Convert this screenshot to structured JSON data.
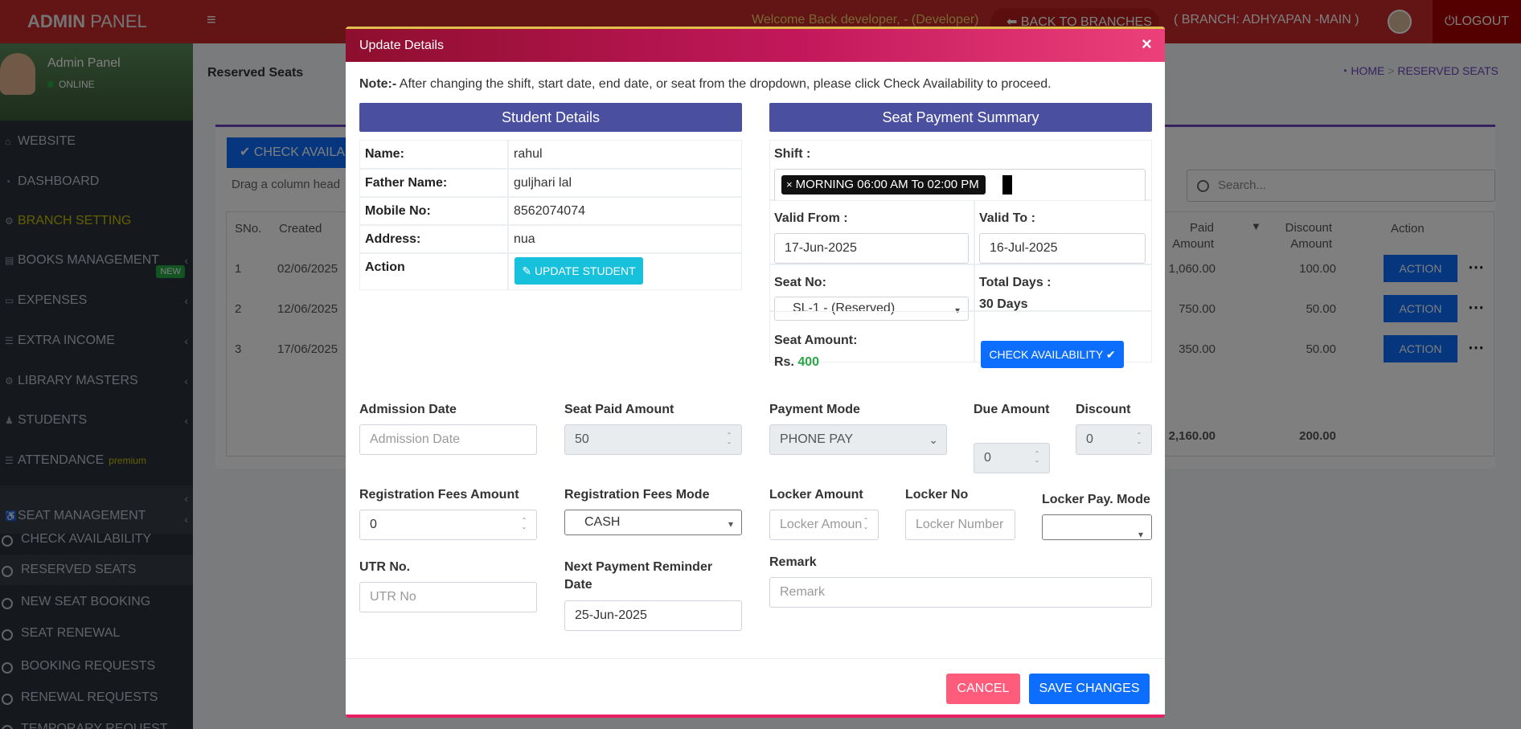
{
  "topbar": {
    "brand_bold": "ADMIN",
    "brand_rest": " PANEL",
    "welcome": "Welcome Back developer, - (Developer)",
    "back_to_branches": "BACK TO BRANCHES",
    "branch": "( BRANCH: ADHYAPAN -MAIN )",
    "logout": "LOGOUT"
  },
  "sidebar": {
    "user_name": "Admin Panel",
    "user_status": "ONLINE",
    "items": [
      {
        "label": "WEBSITE"
      },
      {
        "label": "DASHBOARD"
      },
      {
        "label": "BRANCH SETTING"
      },
      {
        "label": "BOOKS MANAGEMENT",
        "badge": "NEW"
      },
      {
        "label": "EXPENSES"
      },
      {
        "label": "EXTRA INCOME"
      },
      {
        "label": "LIBRARY MASTERS"
      },
      {
        "label": "STUDENTS"
      },
      {
        "label": "ATTENDANCE",
        "badge": "premium"
      },
      {
        "label": "SEAT MANAGEMENT"
      }
    ],
    "sub_items": [
      {
        "label": "CHECK AVAILABILITY"
      },
      {
        "label": "RESERVED SEATS"
      },
      {
        "label": "NEW SEAT BOOKING"
      },
      {
        "label": "SEAT RENEWAL"
      },
      {
        "label": "BOOKING REQUESTS"
      },
      {
        "label": "RENEWAL REQUESTS"
      },
      {
        "label": "TEMPORARY REQUEST"
      }
    ]
  },
  "page": {
    "title": "Reserved Seats",
    "breadcrumb_home": "HOME",
    "breadcrumb_current": "RESERVED SEATS",
    "check_button": "CHECK AVAILA",
    "drag_hint": "Drag a column head",
    "search_placeholder": "Search...",
    "table": {
      "headers": {
        "sno": "SNo.",
        "created": "Created",
        "paid": "Paid Amount",
        "discount": "Discount Amount",
        "action": "Action"
      },
      "rows": [
        {
          "sno": "1",
          "created": "02/06/2025",
          "paid": "1,060.00",
          "discount": "100.00",
          "action": "ACTION"
        },
        {
          "sno": "2",
          "created": "12/06/2025",
          "paid": "750.00",
          "discount": "50.00",
          "action": "ACTION"
        },
        {
          "sno": "3",
          "created": "17/06/2025",
          "paid": "350.00",
          "discount": "50.00",
          "action": "ACTION"
        }
      ],
      "total_paid": "2,160.00",
      "total_discount": "200.00"
    }
  },
  "modal": {
    "title": "Update Details",
    "note_label": "Note:-",
    "note_text": " After changing the shift, start date, end date, or seat from the dropdown, please click Check Availability to proceed.",
    "student": {
      "heading": "Student Details",
      "rows": [
        {
          "label": "Name:",
          "value": "rahul"
        },
        {
          "label": "Father Name:",
          "value": "guljhari lal"
        },
        {
          "label": "Mobile No:",
          "value": "8562074074"
        },
        {
          "label": "Address:",
          "value": "nua"
        }
      ],
      "action_label": "Action",
      "update_button": "UPDATE STUDENT"
    },
    "summary": {
      "heading": "Seat Payment Summary",
      "shift_label": "Shift :",
      "shift_tag": "MORNING 06:00 AM To 02:00 PM",
      "valid_from_label": "Valid From :",
      "valid_from": "17-Jun-2025",
      "valid_to_label": "Valid To :",
      "valid_to": "16-Jul-2025",
      "seat_no_label": "Seat No:",
      "seat_no": "SL-1 - (Reserved)",
      "total_days_label": "Total Days :",
      "total_days": "30 Days",
      "seat_amount_label": "Seat Amount:",
      "seat_amount_prefix": "Rs.",
      "seat_amount": "400",
      "check_button": "CHECK AVAILABILITY"
    },
    "form": {
      "admission_date_label": "Admission Date",
      "admission_date_placeholder": "Admission Date",
      "seat_paid_label": "Seat Paid Amount",
      "seat_paid": "50",
      "payment_mode_label": "Payment Mode",
      "payment_mode": "PHONE PAY",
      "due_label": "Due Amount",
      "due": "0",
      "discount_label": "Discount",
      "discount": "0",
      "reg_fee_label": "Registration Fees Amount",
      "reg_fee": "0",
      "reg_mode_label": "Registration Fees Mode",
      "reg_mode": "CASH",
      "locker_amount_label": "Locker Amount",
      "locker_amount_placeholder": "Locker Amount",
      "locker_no_label": "Locker No",
      "locker_no_placeholder": "Locker Number",
      "locker_mode_label": "Locker Pay. Mode",
      "locker_mode": "",
      "utr_label": "UTR No.",
      "utr_placeholder": "UTR No",
      "reminder_label": "Next Payment Reminder Date",
      "reminder": "25-Jun-2025",
      "remark_label": "Remark",
      "remark_placeholder": "Remark"
    },
    "cancel": "CANCEL",
    "save": "SAVE CHANGES"
  }
}
